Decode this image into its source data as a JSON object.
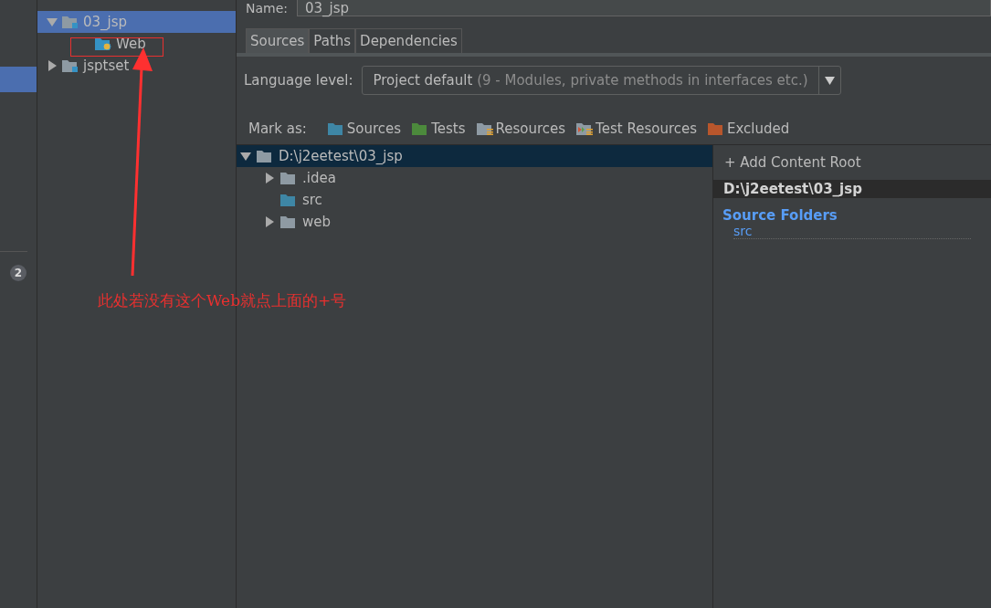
{
  "sidebar": {
    "badge": "2"
  },
  "module_tree": [
    {
      "label": "03_jsp",
      "kind": "module",
      "expanded": true,
      "selected": true,
      "children": [
        {
          "label": "Web",
          "kind": "facet",
          "expanded": false,
          "selected": false
        }
      ]
    },
    {
      "label": "jsptset",
      "kind": "module",
      "expanded": false,
      "selected": false
    }
  ],
  "name_field": {
    "label": "Name:",
    "value": "03_jsp"
  },
  "tabs": [
    {
      "label": "Sources",
      "selected": true
    },
    {
      "label": "Paths",
      "selected": false
    },
    {
      "label": "Dependencies",
      "selected": false
    }
  ],
  "language_level": {
    "label": "Language level:",
    "value": "Project default",
    "hint": "(9 - Modules, private methods in interfaces etc.)"
  },
  "mark_as": {
    "label": "Mark as:",
    "options": [
      {
        "label": "Sources",
        "kind": "plain",
        "color": "#3e86a5"
      },
      {
        "label": "Tests",
        "kind": "plain",
        "color": "#4c8a3c"
      },
      {
        "label": "Resources",
        "kind": "resource",
        "color": "#8e9aa3"
      },
      {
        "label": "Test Resources",
        "kind": "test-resource",
        "color": "#8e9aa3"
      },
      {
        "label": "Excluded",
        "kind": "plain",
        "color": "#b8562c"
      }
    ]
  },
  "content_tree": [
    {
      "label": "D:\\j2eetest\\03_jsp",
      "kind": "folder",
      "expanded": true,
      "selected": true,
      "children": [
        {
          "label": ".idea",
          "kind": "folder",
          "expanded": false,
          "selected": false
        },
        {
          "label": "src",
          "kind": "source",
          "expanded": false,
          "selected": false
        },
        {
          "label": "web",
          "kind": "folder",
          "expanded": false,
          "selected": false
        }
      ]
    }
  ],
  "content_root_panel": {
    "add_button": "+ Add Content Root",
    "root_path": "D:\\j2eetest\\03_jsp",
    "section_title": "Source Folders",
    "folders": [
      "src"
    ]
  },
  "annotation": {
    "text": "此处若没有这个Web就点上面的+号"
  }
}
